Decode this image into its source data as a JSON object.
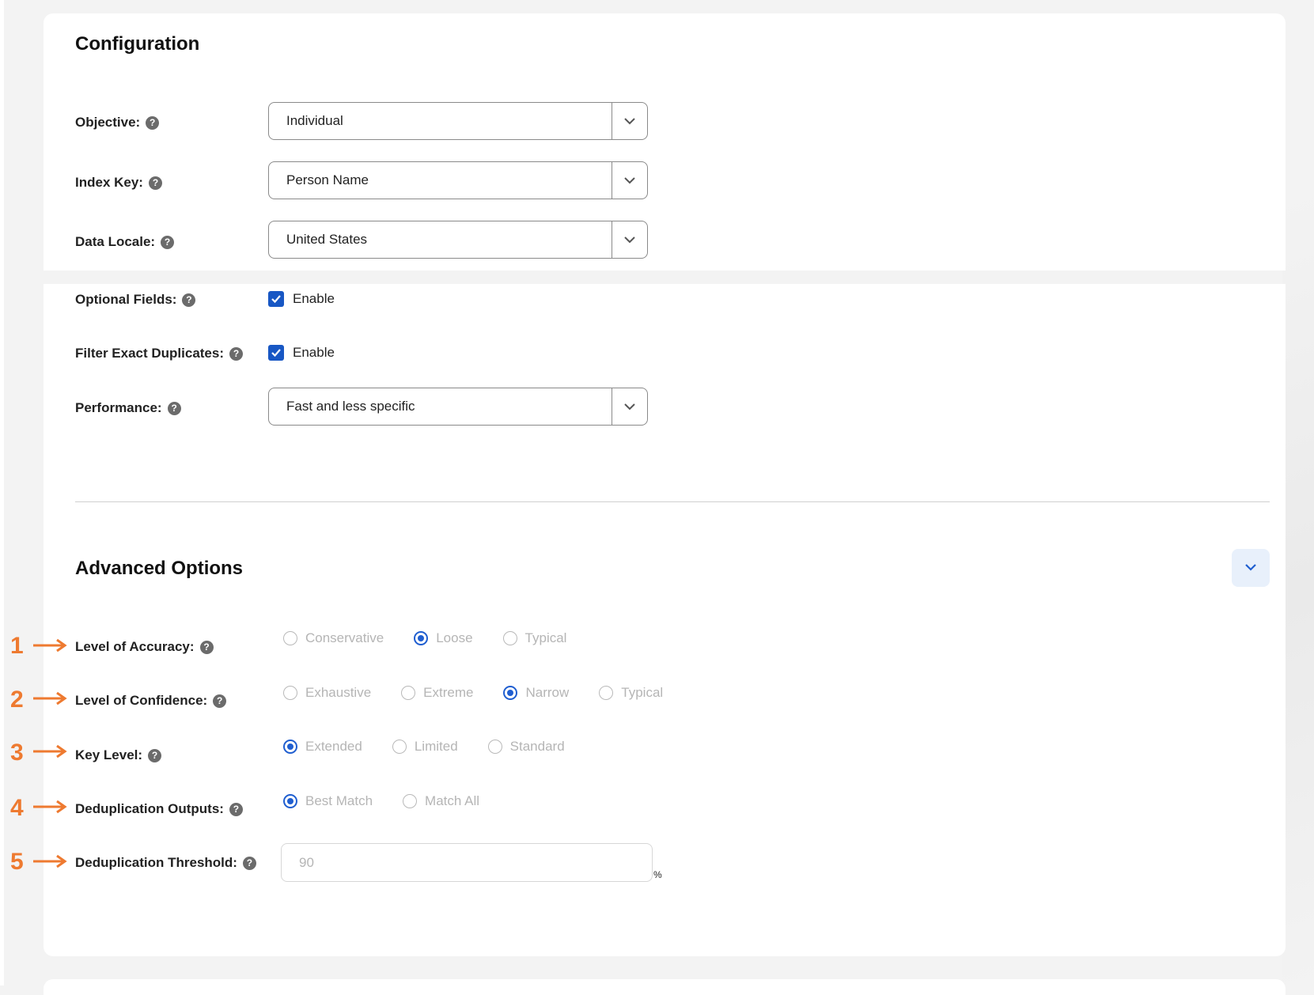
{
  "configuration": {
    "title": "Configuration",
    "objective": {
      "label": "Objective:",
      "value": "Individual"
    },
    "index_key": {
      "label": "Index Key:",
      "value": "Person Name"
    },
    "data_locale": {
      "label": "Data Locale:",
      "value": "United States"
    },
    "optional_fields": {
      "label": "Optional Fields:",
      "checkbox_label": "Enable",
      "checked": true
    },
    "filter_exact_duplicates": {
      "label": "Filter Exact Duplicates:",
      "checkbox_label": "Enable",
      "checked": true
    },
    "performance": {
      "label": "Performance:",
      "value": "Fast and less specific"
    }
  },
  "advanced": {
    "title": "Advanced Options",
    "level_of_accuracy": {
      "label": "Level of Accuracy:",
      "options": [
        "Conservative",
        "Loose",
        "Typical"
      ],
      "selected": "Loose"
    },
    "level_of_confidence": {
      "label": "Level of Confidence:",
      "options": [
        "Exhaustive",
        "Extreme",
        "Narrow",
        "Typical"
      ],
      "selected": "Narrow"
    },
    "key_level": {
      "label": "Key Level:",
      "options": [
        "Extended",
        "Limited",
        "Standard"
      ],
      "selected": "Extended"
    },
    "deduplication_outputs": {
      "label": "Deduplication Outputs:",
      "options": [
        "Best Match",
        "Match All"
      ],
      "selected": "Best Match"
    },
    "deduplication_threshold": {
      "label": "Deduplication Threshold:",
      "placeholder": "90",
      "unit": "%"
    }
  },
  "annotations": [
    "1",
    "2",
    "3",
    "4",
    "5"
  ],
  "colors": {
    "accent": "#1f5ed0",
    "annotation": "#ee7a30"
  },
  "icons": {
    "help": "question-circle-icon",
    "dropdown": "chevron-down-icon",
    "checkbox": "checkmark-icon",
    "arrow": "arrow-right-icon"
  }
}
